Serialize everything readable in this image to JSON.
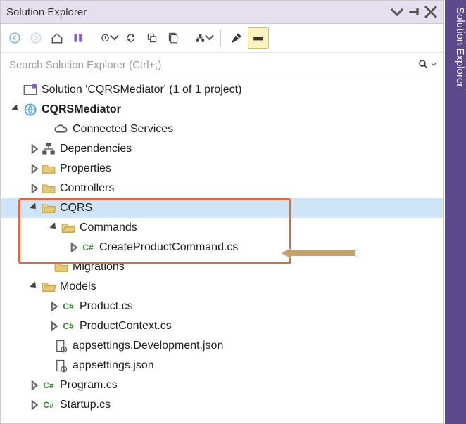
{
  "sidebar_title": "Solution Explorer",
  "titlebar": {
    "title": "Solution Explorer"
  },
  "search": {
    "placeholder": "Search Solution Explorer (Ctrl+;)"
  },
  "tree": {
    "solution": "Solution 'CQRSMediator' (1 of 1 project)",
    "project": "CQRSMediator",
    "connected": "Connected Services",
    "dependencies": "Dependencies",
    "properties": "Properties",
    "controllers": "Controllers",
    "cqrs": "CQRS",
    "commands": "Commands",
    "createcmd": "CreateProductCommand.cs",
    "migrations": "Migrations",
    "models": "Models",
    "product": "Product.cs",
    "productcontext": "ProductContext.cs",
    "appsettingsdev": "appsettings.Development.json",
    "appsettings": "appsettings.json",
    "program": "Program.cs",
    "startup": "Startup.cs"
  }
}
